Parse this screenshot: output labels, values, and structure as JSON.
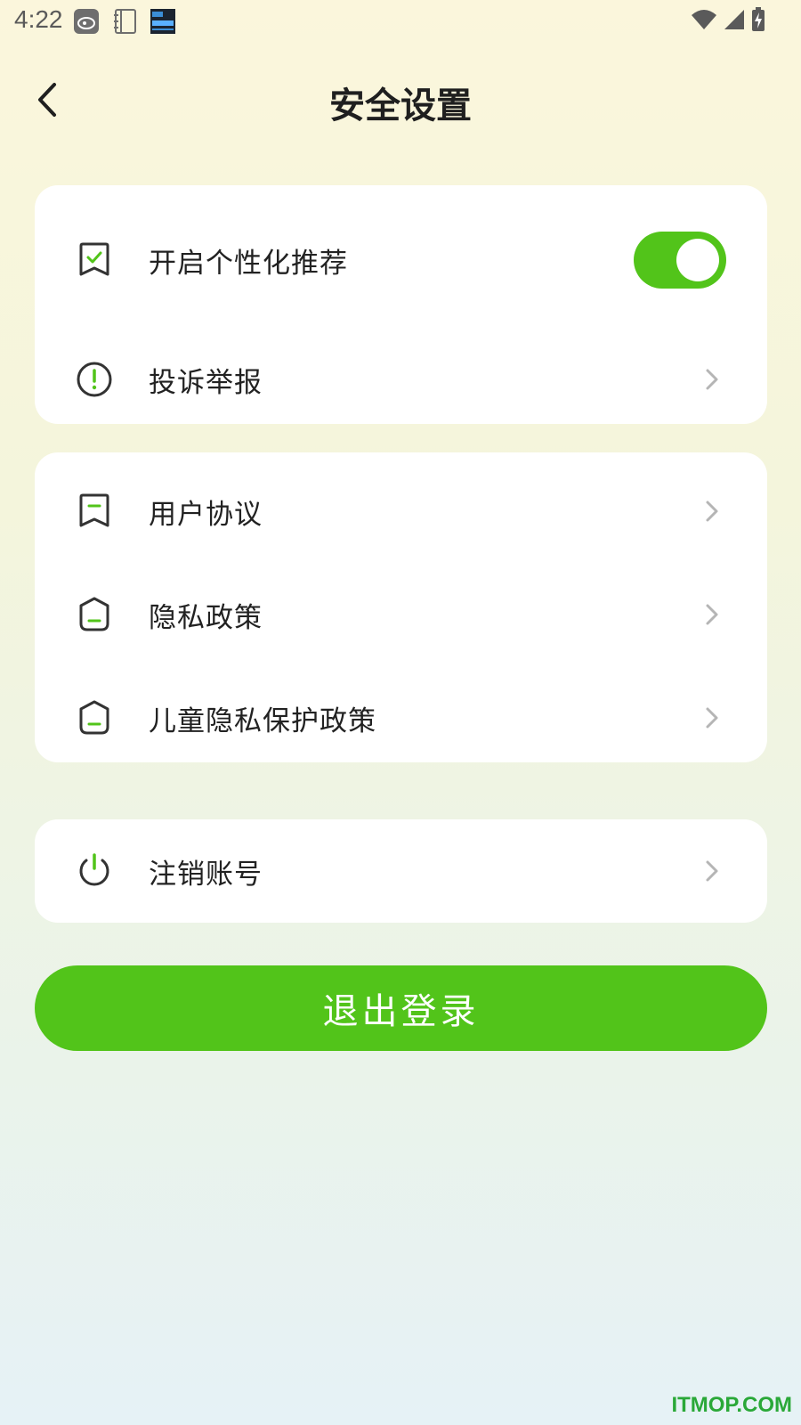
{
  "status_bar": {
    "time": "4:22",
    "notification_icons": [
      "sina-weibo-icon",
      "notebook-icon",
      "clock-widget-icon"
    ]
  },
  "header": {
    "title": "安全设置"
  },
  "sections": [
    {
      "items": [
        {
          "label": "开启个性化推荐",
          "icon": "bookmark-check-icon",
          "type": "toggle",
          "enabled": true
        },
        {
          "label": "投诉举报",
          "icon": "alert-circle-icon",
          "type": "link"
        }
      ]
    },
    {
      "items": [
        {
          "label": "用户协议",
          "icon": "bookmark-minus-icon",
          "type": "link"
        },
        {
          "label": "隐私政策",
          "icon": "shield-icon",
          "type": "link"
        },
        {
          "label": "儿童隐私保护政策",
          "icon": "shield-icon",
          "type": "link"
        }
      ]
    },
    {
      "items": [
        {
          "label": "注销账号",
          "icon": "power-icon",
          "type": "link"
        }
      ]
    }
  ],
  "logout_label": "退出登录",
  "watermark": "ITMOP.COM",
  "colors": {
    "accent": "#52c41a",
    "card": "#ffffff",
    "icon_stroke": "#333333"
  }
}
